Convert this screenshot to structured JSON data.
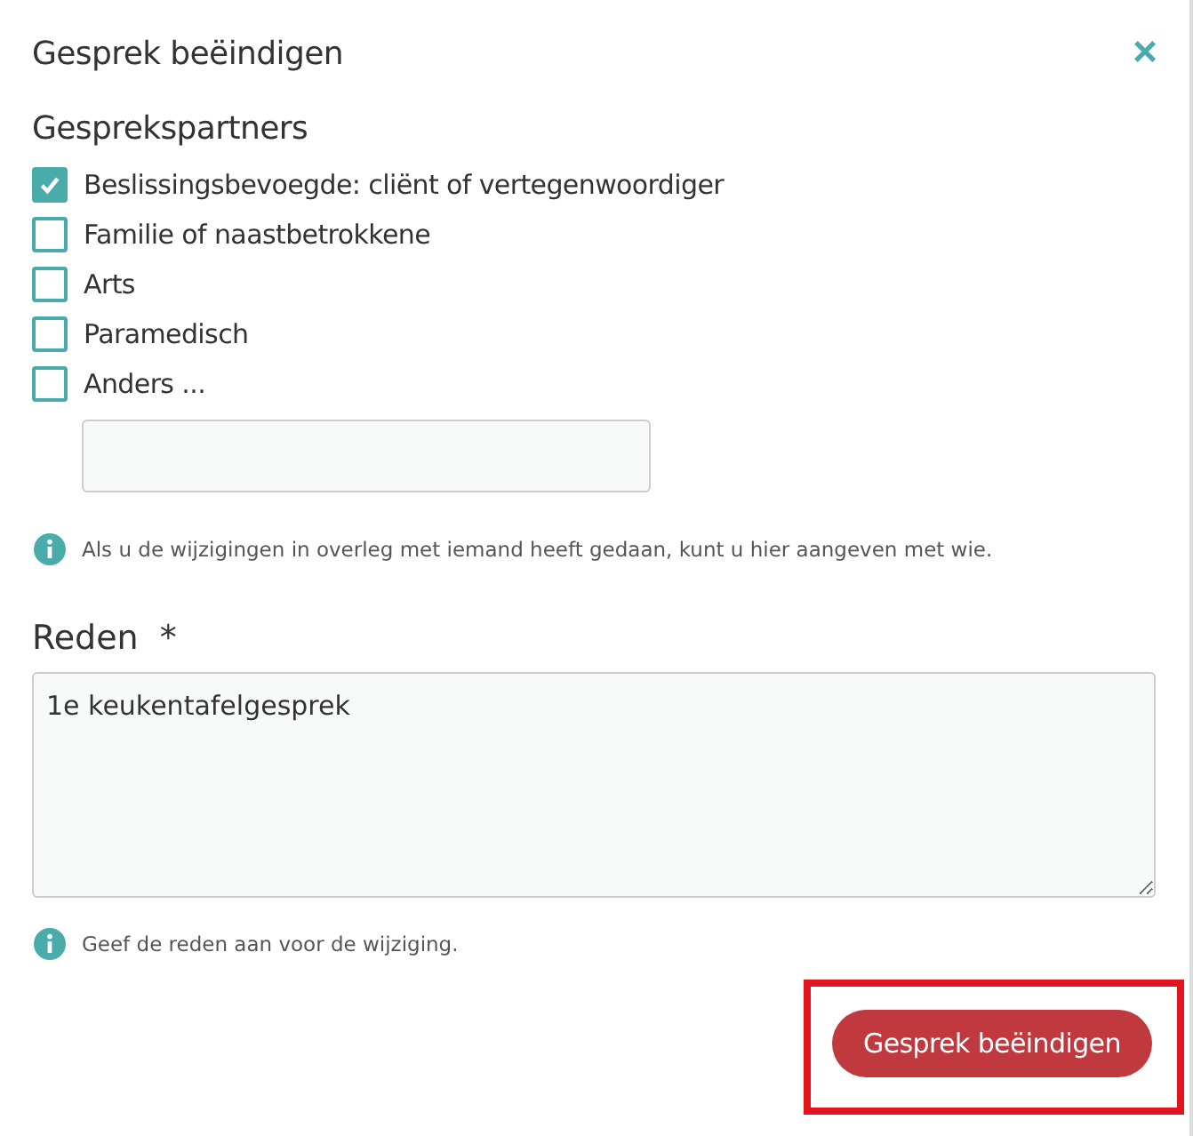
{
  "dialog": {
    "title": "Gesprek beëindigen",
    "close": "×"
  },
  "partners": {
    "heading": "Gesprekspartners",
    "options": [
      {
        "label": "Beslissingsbevoegde: cliënt of vertegenwoordiger",
        "checked": true
      },
      {
        "label": "Familie of naastbetrokkene",
        "checked": false
      },
      {
        "label": "Arts",
        "checked": false
      },
      {
        "label": "Paramedisch",
        "checked": false
      },
      {
        "label": "Anders ...",
        "checked": false
      }
    ],
    "hint": "Als u de wijzigingen in overleg met iemand heeft gedaan, kunt u hier aangeven met wie."
  },
  "reason": {
    "label": "Reden",
    "required_mark": "*",
    "value": "1e keukentafelgesprek",
    "hint": "Geef de reden aan voor de wijziging."
  },
  "submit": {
    "label": "Gesprek beëindigen",
    "highlighted": true
  }
}
